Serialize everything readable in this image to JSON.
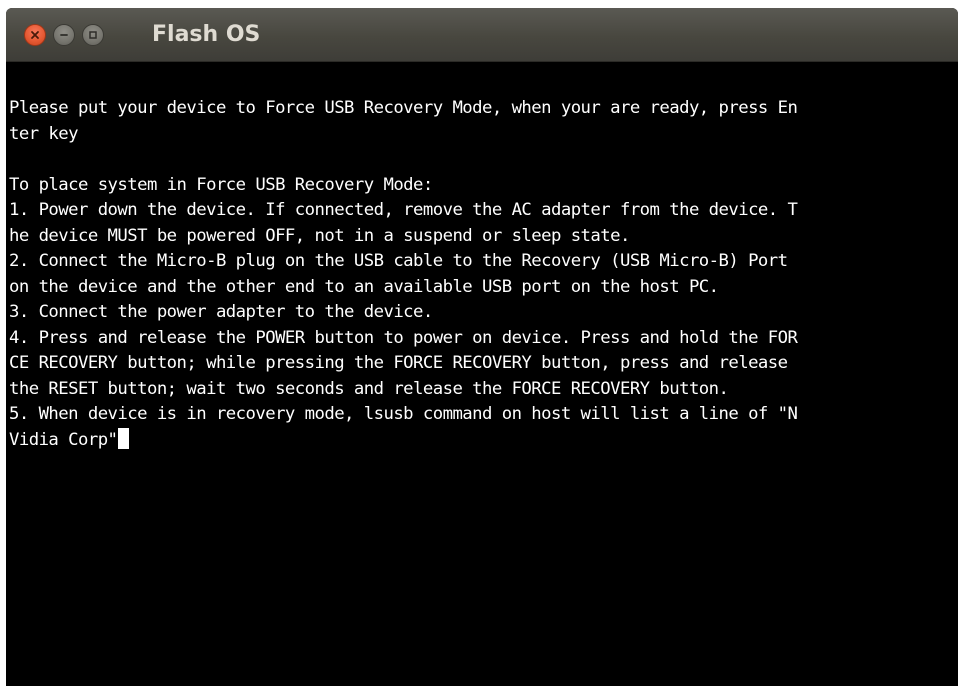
{
  "window": {
    "title": "Flash OS",
    "controls": {
      "close": "close-icon",
      "minimize": "minimize-icon",
      "maximize": "maximize-icon"
    }
  },
  "terminal": {
    "lines": [
      "Please put your device to Force USB Recovery Mode, when your are ready, press En",
      "ter key",
      "",
      "To place system in Force USB Recovery Mode:",
      "1. Power down the device. If connected, remove the AC adapter from the device. T",
      "he device MUST be powered OFF, not in a suspend or sleep state.",
      "2. Connect the Micro-B plug on the USB cable to the Recovery (USB Micro-B) Port",
      "on the device and the other end to an available USB port on the host PC.",
      "3. Connect the power adapter to the device.",
      "4. Press and release the POWER button to power on device. Press and hold the FOR",
      "CE RECOVERY button; while pressing the FORCE RECOVERY button, press and release",
      "the RESET button; wait two seconds and release the FORCE RECOVERY button.",
      "5. When device is in recovery mode, lsusb command on host will list a line of \"N",
      "Vidia Corp\""
    ]
  },
  "colors": {
    "terminal_bg": "#000000",
    "terminal_fg": "#ffffff",
    "close_button": "#e65a34",
    "titlebar_bg": "#48473f",
    "title_text": "#dfdbd2"
  }
}
